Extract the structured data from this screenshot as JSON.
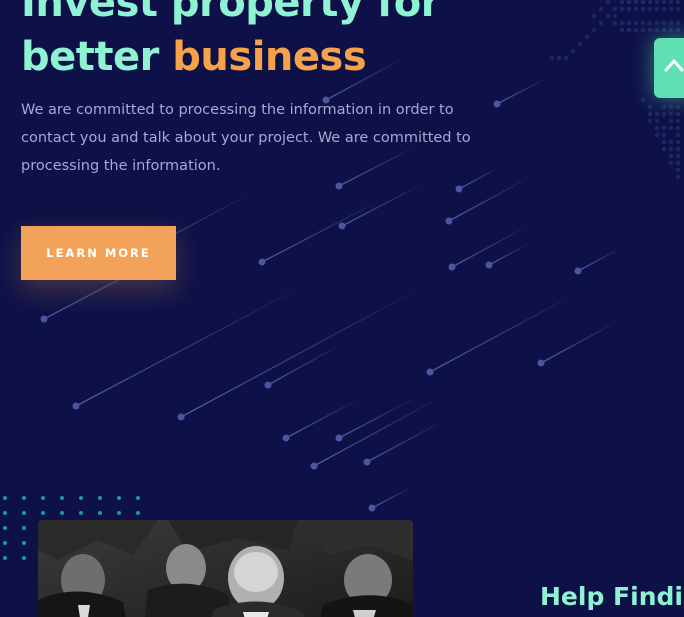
{
  "hero": {
    "title_line1": "Invest property for",
    "title_line2_plain": "better ",
    "title_line2_accent": "business",
    "description": "We are committed to processing the information in order to contact you and talk about your project. We are committed to processing the information.",
    "cta_label": "LEARN MORE"
  },
  "scroll_top": {
    "icon": "chevron-up-icon"
  },
  "help_section": {
    "heading": "Help Findin"
  },
  "colors": {
    "background": "#0e1147",
    "heading": "#8ff3d3",
    "accent": "#f5a24b",
    "button": "#f3a259",
    "scroll_button": "#5fe0b2",
    "body_text": "#a6a9d0"
  }
}
